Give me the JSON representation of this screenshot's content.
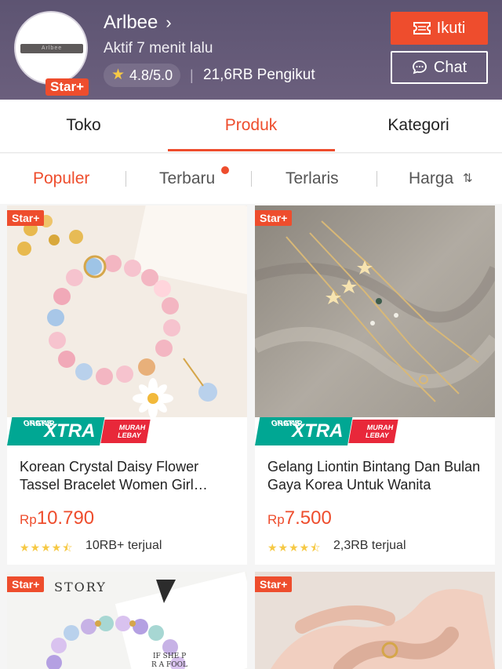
{
  "shop": {
    "logo_text": "Arlbee",
    "badge": "Star+",
    "name": "Arlbee",
    "active": "Aktif 7 menit lalu",
    "rating": "4.8/5.0",
    "followers": "21,6RB Pengikut",
    "follow_label": "Ikuti",
    "chat_label": "Chat"
  },
  "tabs": [
    {
      "label": "Toko"
    },
    {
      "label": "Produk"
    },
    {
      "label": "Kategori"
    }
  ],
  "sort": [
    {
      "label": "Populer"
    },
    {
      "label": "Terbaru"
    },
    {
      "label": "Terlaris"
    },
    {
      "label": "Harga"
    }
  ],
  "promo": {
    "gratis": "GRATIS",
    "ongkir": "ONGKIR",
    "xtra": "XTRA",
    "murah": "MURAH",
    "lebay": "LEBAY"
  },
  "products": [
    {
      "badge": "Star+",
      "title": "Korean Crystal Daisy Flower Tassel Bracelet Women Girl Bracelet",
      "currency": "Rp",
      "price": "10.790",
      "rating_stars": 4.5,
      "sold": "10RB+ terjual"
    },
    {
      "badge": "Star+",
      "title": "Gelang Liontin Bintang Dan Bulan Gaya Korea Untuk Wanita",
      "currency": "Rp",
      "price": "7.500",
      "rating_stars": 4.5,
      "sold": "2,3RB terjual"
    },
    {
      "badge": "Star+",
      "image_text": "STORY"
    },
    {
      "badge": "Star+"
    }
  ],
  "colors": {
    "accent": "#ee4d2d",
    "header_bg": "#5d5472",
    "star": "#f6c945",
    "promo_green": "#00a793",
    "promo_red": "#e8283a"
  }
}
